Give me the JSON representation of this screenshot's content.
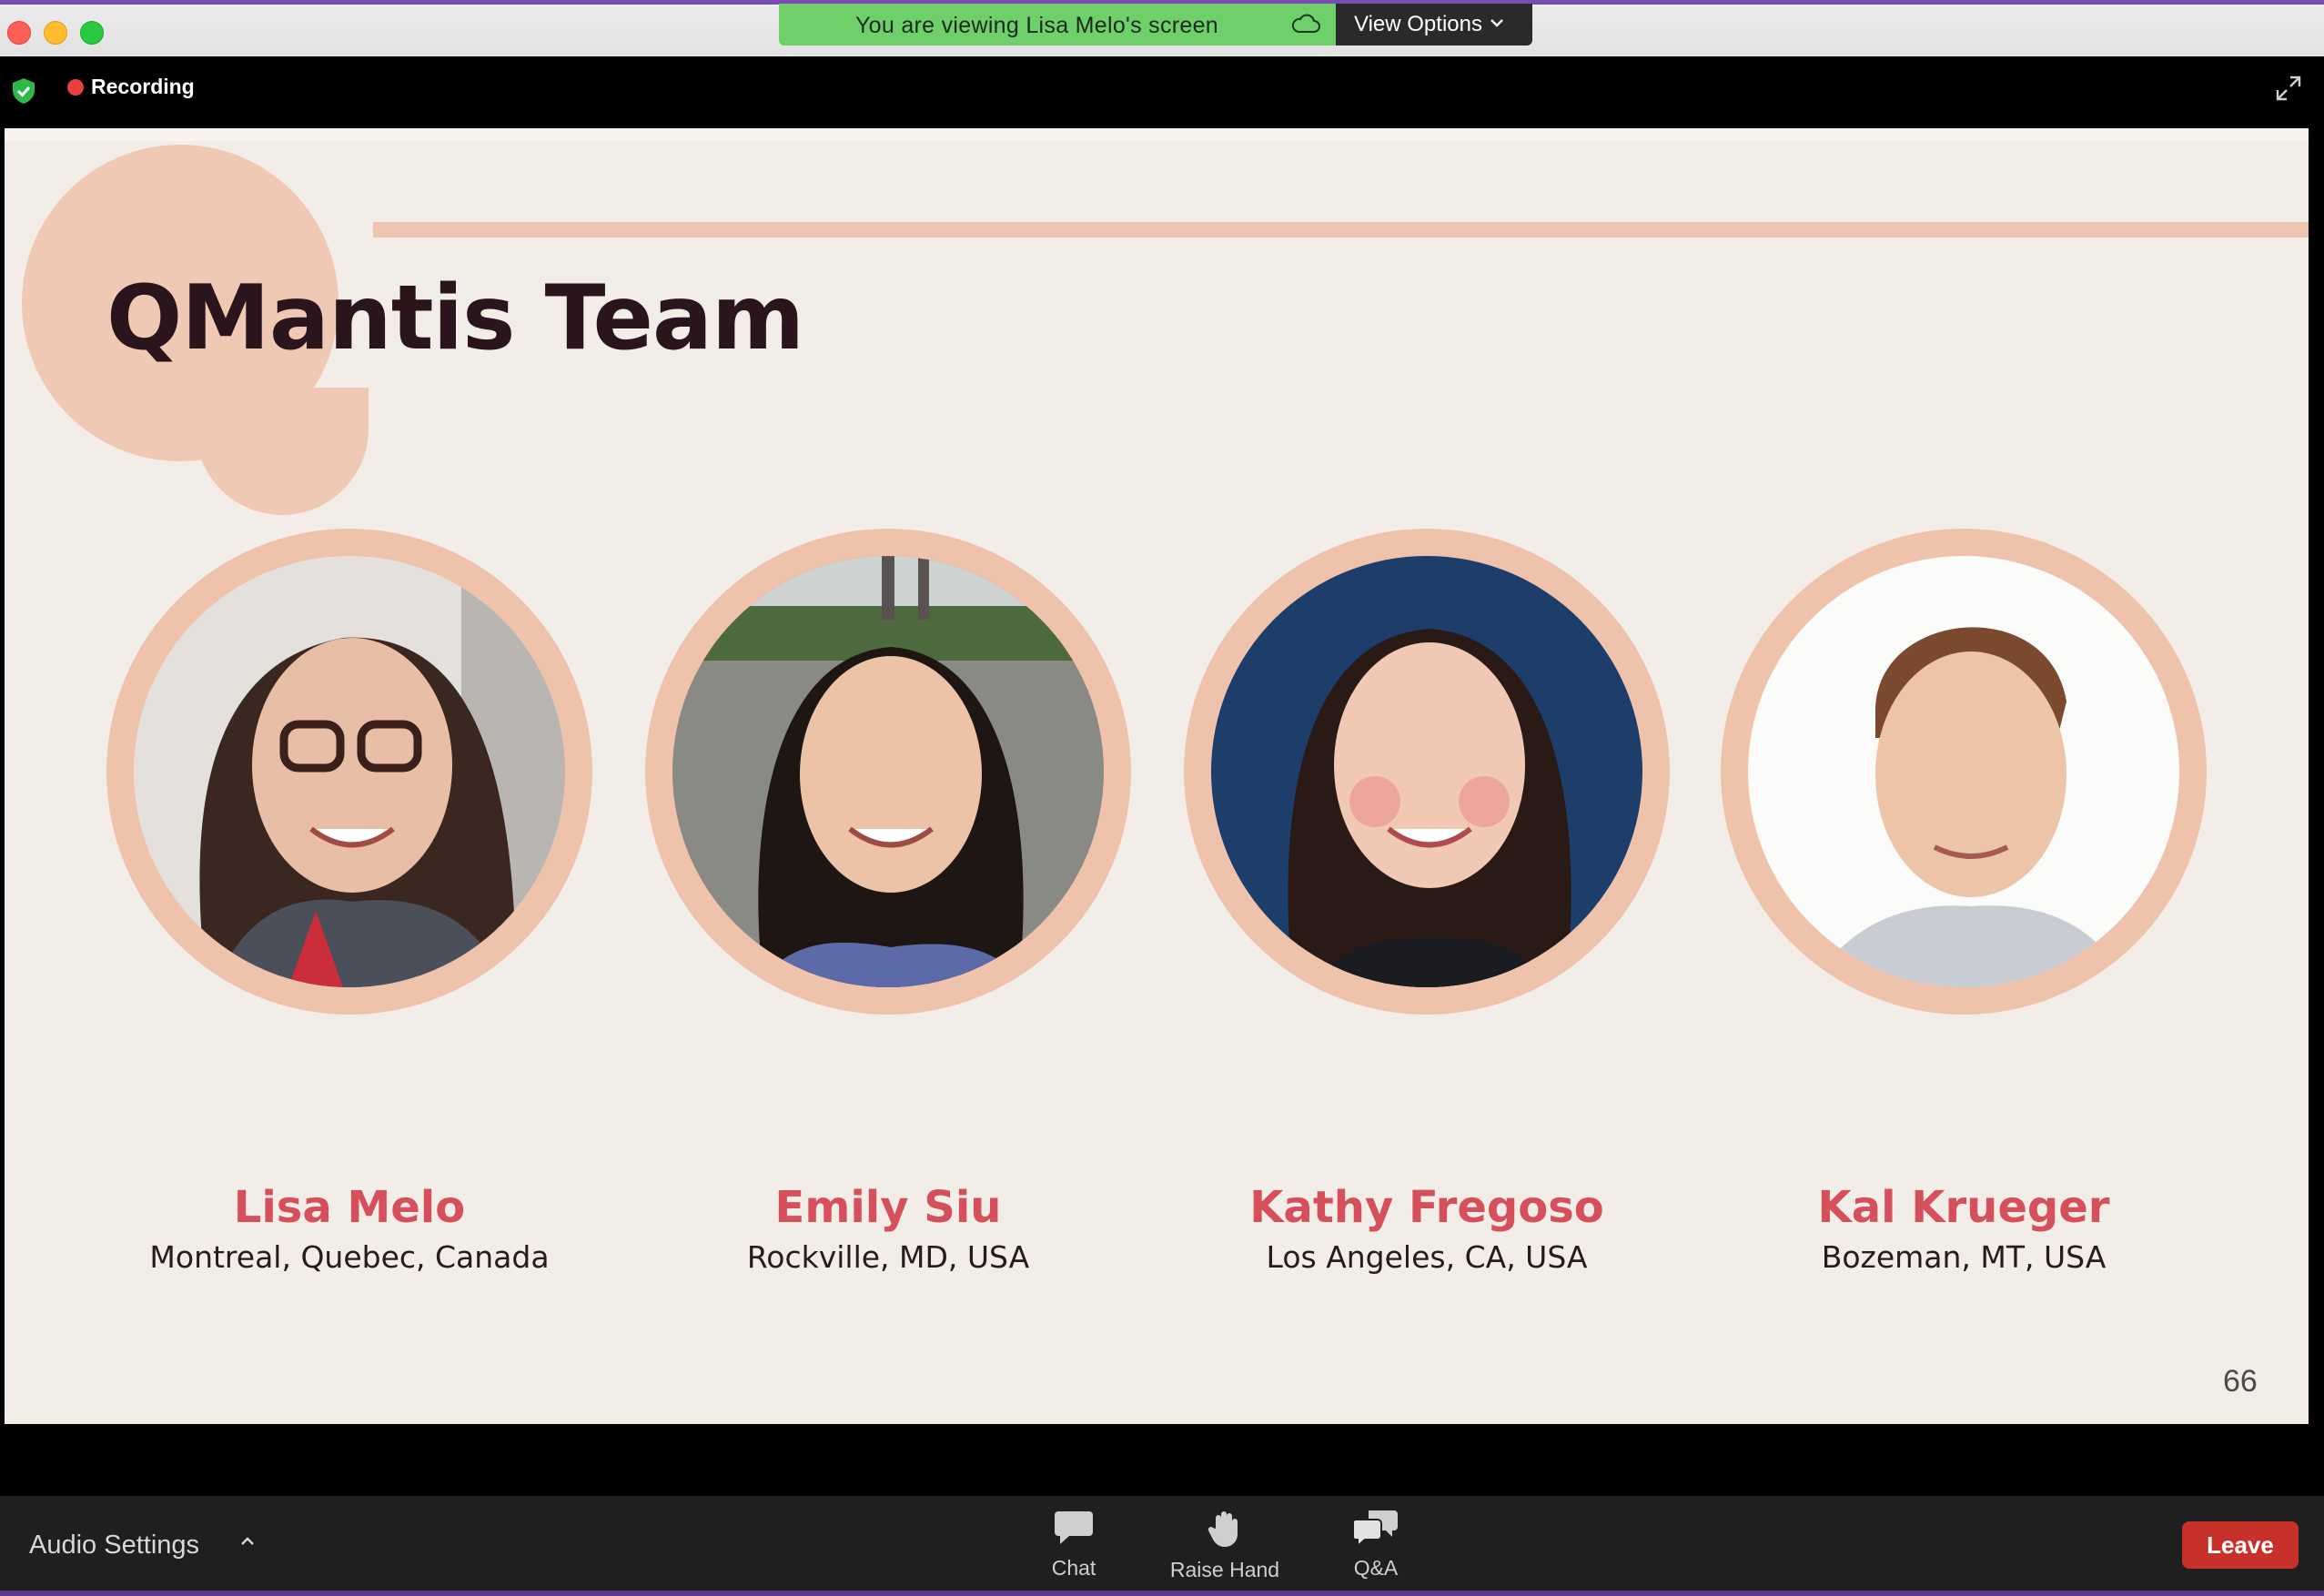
{
  "window": {
    "banner_text": "You are viewing Lisa Melo's screen",
    "view_options_label": "View Options",
    "recording_label": "Recording"
  },
  "slide": {
    "title": "QMantis Team",
    "page_number": "66",
    "members": [
      {
        "name": "Lisa Melo",
        "location": "Montreal, Quebec, Canada"
      },
      {
        "name": "Emily Siu",
        "location": "Rockville, MD, USA"
      },
      {
        "name": "Kathy Fregoso",
        "location": "Los Angeles, CA, USA"
      },
      {
        "name": "Kal Krueger",
        "location": "Bozeman, MT, USA"
      }
    ]
  },
  "toolbar": {
    "audio_settings_label": "Audio Settings",
    "chat_label": "Chat",
    "raise_hand_label": "Raise Hand",
    "qa_label": "Q&A",
    "leave_label": "Leave"
  },
  "colors": {
    "banner_green": "#6fd06b",
    "accent_peach": "#efc2ac",
    "name_red": "#d6505b",
    "leave_red": "#c8302b",
    "recording_red": "#e8413b"
  },
  "icons": [
    "close-window-icon",
    "minimize-window-icon",
    "zoom-window-icon",
    "cloud-icon",
    "chevron-down-icon",
    "security-shield-icon",
    "expand-icon",
    "chevron-up-icon",
    "chat-icon",
    "raise-hand-icon",
    "qa-icon"
  ]
}
